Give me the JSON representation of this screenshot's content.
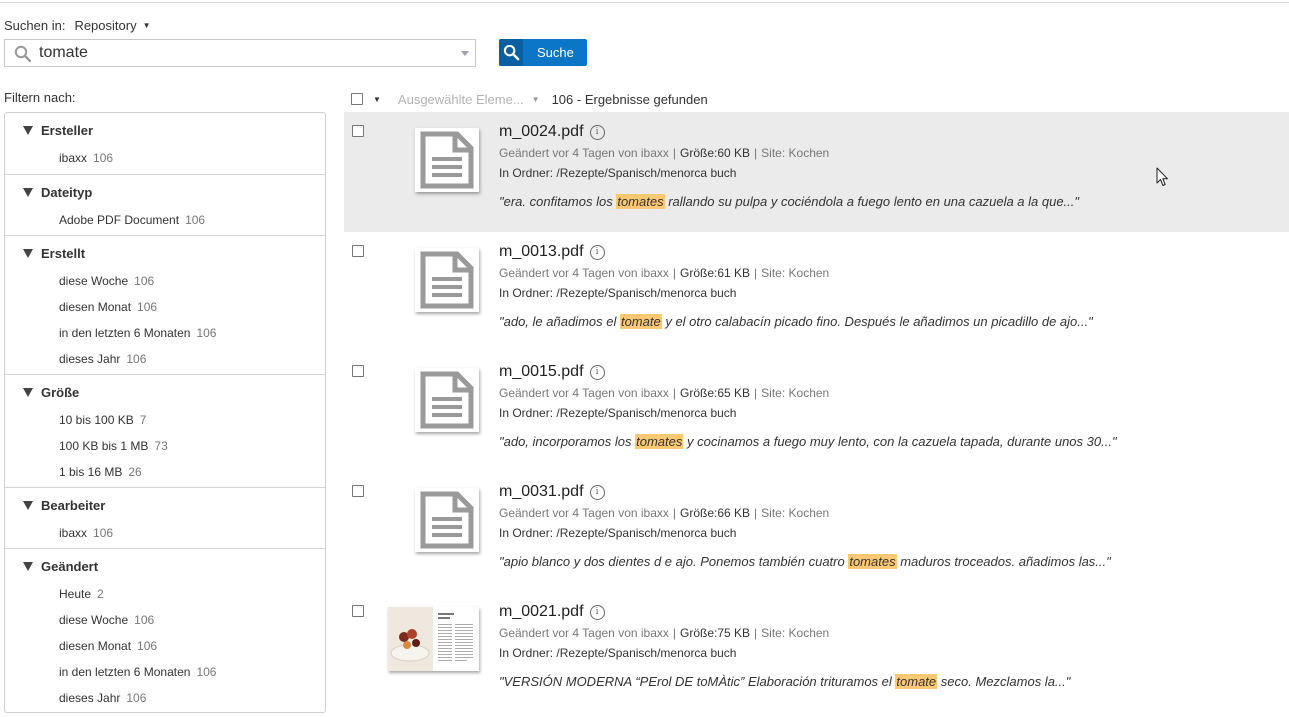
{
  "search": {
    "scope_label": "Suchen in:",
    "scope_value": "Repository",
    "query": "tomate",
    "button_label": "Suche"
  },
  "filters": {
    "title": "Filtern nach:",
    "groups": [
      {
        "title": "Ersteller",
        "items": [
          {
            "label": "ibaxx",
            "count": "106"
          }
        ]
      },
      {
        "title": "Dateityp",
        "items": [
          {
            "label": "Adobe PDF Document",
            "count": "106"
          }
        ]
      },
      {
        "title": "Erstellt",
        "items": [
          {
            "label": "diese Woche",
            "count": "106"
          },
          {
            "label": "diesen Monat",
            "count": "106"
          },
          {
            "label": "in den letzten 6 Monaten",
            "count": "106"
          },
          {
            "label": "dieses Jahr",
            "count": "106"
          }
        ]
      },
      {
        "title": "Größe",
        "items": [
          {
            "label": "10 bis 100 KB",
            "count": "7"
          },
          {
            "label": "100 KB bis 1 MB",
            "count": "73"
          },
          {
            "label": "1 bis 16 MB",
            "count": "26"
          }
        ]
      },
      {
        "title": "Bearbeiter",
        "items": [
          {
            "label": "ibaxx",
            "count": "106"
          }
        ]
      },
      {
        "title": "Geändert",
        "items": [
          {
            "label": "Heute",
            "count": "2"
          },
          {
            "label": "diese Woche",
            "count": "106"
          },
          {
            "label": "diesen Monat",
            "count": "106"
          },
          {
            "label": "in den letzten 6 Monaten",
            "count": "106"
          },
          {
            "label": "dieses Jahr",
            "count": "106"
          }
        ]
      }
    ]
  },
  "results_header": {
    "selected_label": "Ausgewählte Eleme...",
    "count_label": "106 - Ergebnisse gefunden"
  },
  "results": [
    {
      "name": "m_0024.pdf",
      "modified": "Geändert vor 4 Tagen von ibaxx",
      "size": "Größe:60 KB",
      "site": "Site: Kochen",
      "folder_prefix": "In Ordner: ",
      "folder": "/Rezepte/Spanisch/menorca buch",
      "snippet_before": "\"era. confitamos los ",
      "snippet_hl": "tomates",
      "snippet_after": " rallando su pulpa y cociéndola a fuego lento en una cazuela a la que...\"",
      "thumb": "document-icon"
    },
    {
      "name": "m_0013.pdf",
      "modified": "Geändert vor 4 Tagen von ibaxx",
      "size": "Größe:61 KB",
      "site": "Site: Kochen",
      "folder_prefix": "In Ordner: ",
      "folder": "/Rezepte/Spanisch/menorca buch",
      "snippet_before": "\"ado, le añadimos el ",
      "snippet_hl": "tomate",
      "snippet_after": " y el otro calabacín picado fino. Después le añadimos un picadillo de ajo...\"",
      "thumb": "document-icon"
    },
    {
      "name": "m_0015.pdf",
      "modified": "Geändert vor 4 Tagen von ibaxx",
      "size": "Größe:65 KB",
      "site": "Site: Kochen",
      "folder_prefix": "In Ordner: ",
      "folder": "/Rezepte/Spanisch/menorca buch",
      "snippet_before": "\"ado, incorporamos los ",
      "snippet_hl": "tomates",
      "snippet_after": " y cocinamos a fuego muy lento, con la cazuela tapada, durante unos 30...\"",
      "thumb": "document-icon"
    },
    {
      "name": "m_0031.pdf",
      "modified": "Geändert vor 4 Tagen von ibaxx",
      "size": "Größe:66 KB",
      "site": "Site: Kochen",
      "folder_prefix": "In Ordner: ",
      "folder": "/Rezepte/Spanisch/menorca buch",
      "snippet_before": "\"apio blanco y dos dientes d e ajo. Ponemos también cuatro ",
      "snippet_hl": "tomates",
      "snippet_after": " maduros troceados. añadimos las...\"",
      "thumb": "document-icon"
    },
    {
      "name": "m_0021.pdf",
      "modified": "Geändert vor 4 Tagen von ibaxx",
      "size": "Größe:75 KB",
      "site": "Site: Kochen",
      "folder_prefix": "In Ordner: ",
      "folder": "/Rezepte/Spanisch/menorca buch",
      "snippet_before": "\"VERSIÓN MODERNA “PErol DE toMÀtic” Elaboración trituramos el ",
      "snippet_hl": "tomate",
      "snippet_after": " seco. Mezclamos la...\"",
      "thumb": "page-preview"
    }
  ],
  "colors": {
    "accent": "#0b76c5",
    "highlight": "#fcc872",
    "hover_row": "#ebebeb"
  }
}
